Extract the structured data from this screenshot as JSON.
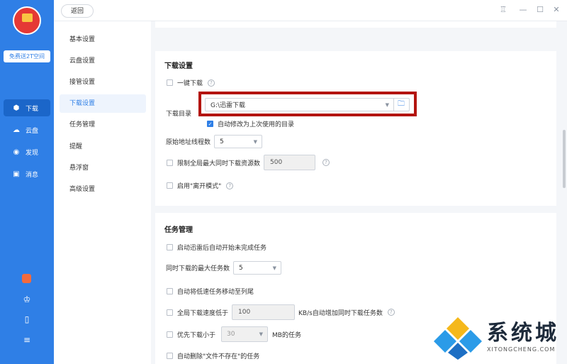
{
  "sidebar": {
    "promo": "免费送2T空间",
    "nav": [
      {
        "label": "下载",
        "icon": "download-icon"
      },
      {
        "label": "云盘",
        "icon": "cloud-icon"
      },
      {
        "label": "发现",
        "icon": "discover-icon"
      },
      {
        "label": "消息",
        "icon": "message-icon"
      }
    ]
  },
  "topbar": {
    "back_label": "返回"
  },
  "settings_nav": {
    "items": [
      "基本设置",
      "云盘设置",
      "接管设置",
      "下载设置",
      "任务管理",
      "提醒",
      "悬浮窗",
      "高级设置"
    ],
    "active": "下载设置"
  },
  "download_section": {
    "title": "下载设置",
    "one_click": "一键下载",
    "dir_label": "下载目录",
    "dir_value": "G:\\迅雷下载",
    "auto_change_dir": "自动修改为上次使用的目录",
    "threads_label": "原始地址线程数",
    "threads_value": "5",
    "limit_global": "限制全局最大同时下载资源数",
    "limit_value": "500",
    "offline_mode": "启用\"离开模式\""
  },
  "task_section": {
    "title": "任务管理",
    "auto_start": "启动迅雷后自动开始未完成任务",
    "max_tasks_label": "同时下载的最大任务数",
    "max_tasks_value": "5",
    "move_slow": "自动将低速任务移动至列尾",
    "speed_below": "全局下载速度低于",
    "speed_value": "100",
    "speed_suffix": "KB/s自动增加同时下载任务数",
    "priority_small": "优先下载小于",
    "priority_value": "30",
    "priority_suffix": "MB的任务",
    "auto_delete": "自动删除\"文件不存在\"的任务"
  },
  "watermark": {
    "title": "系统城",
    "subtitle": "XITONGCHENG.COM"
  },
  "colors": {
    "sidebar_blue": "#2f7fe6",
    "highlight_red": "#b3140f"
  }
}
